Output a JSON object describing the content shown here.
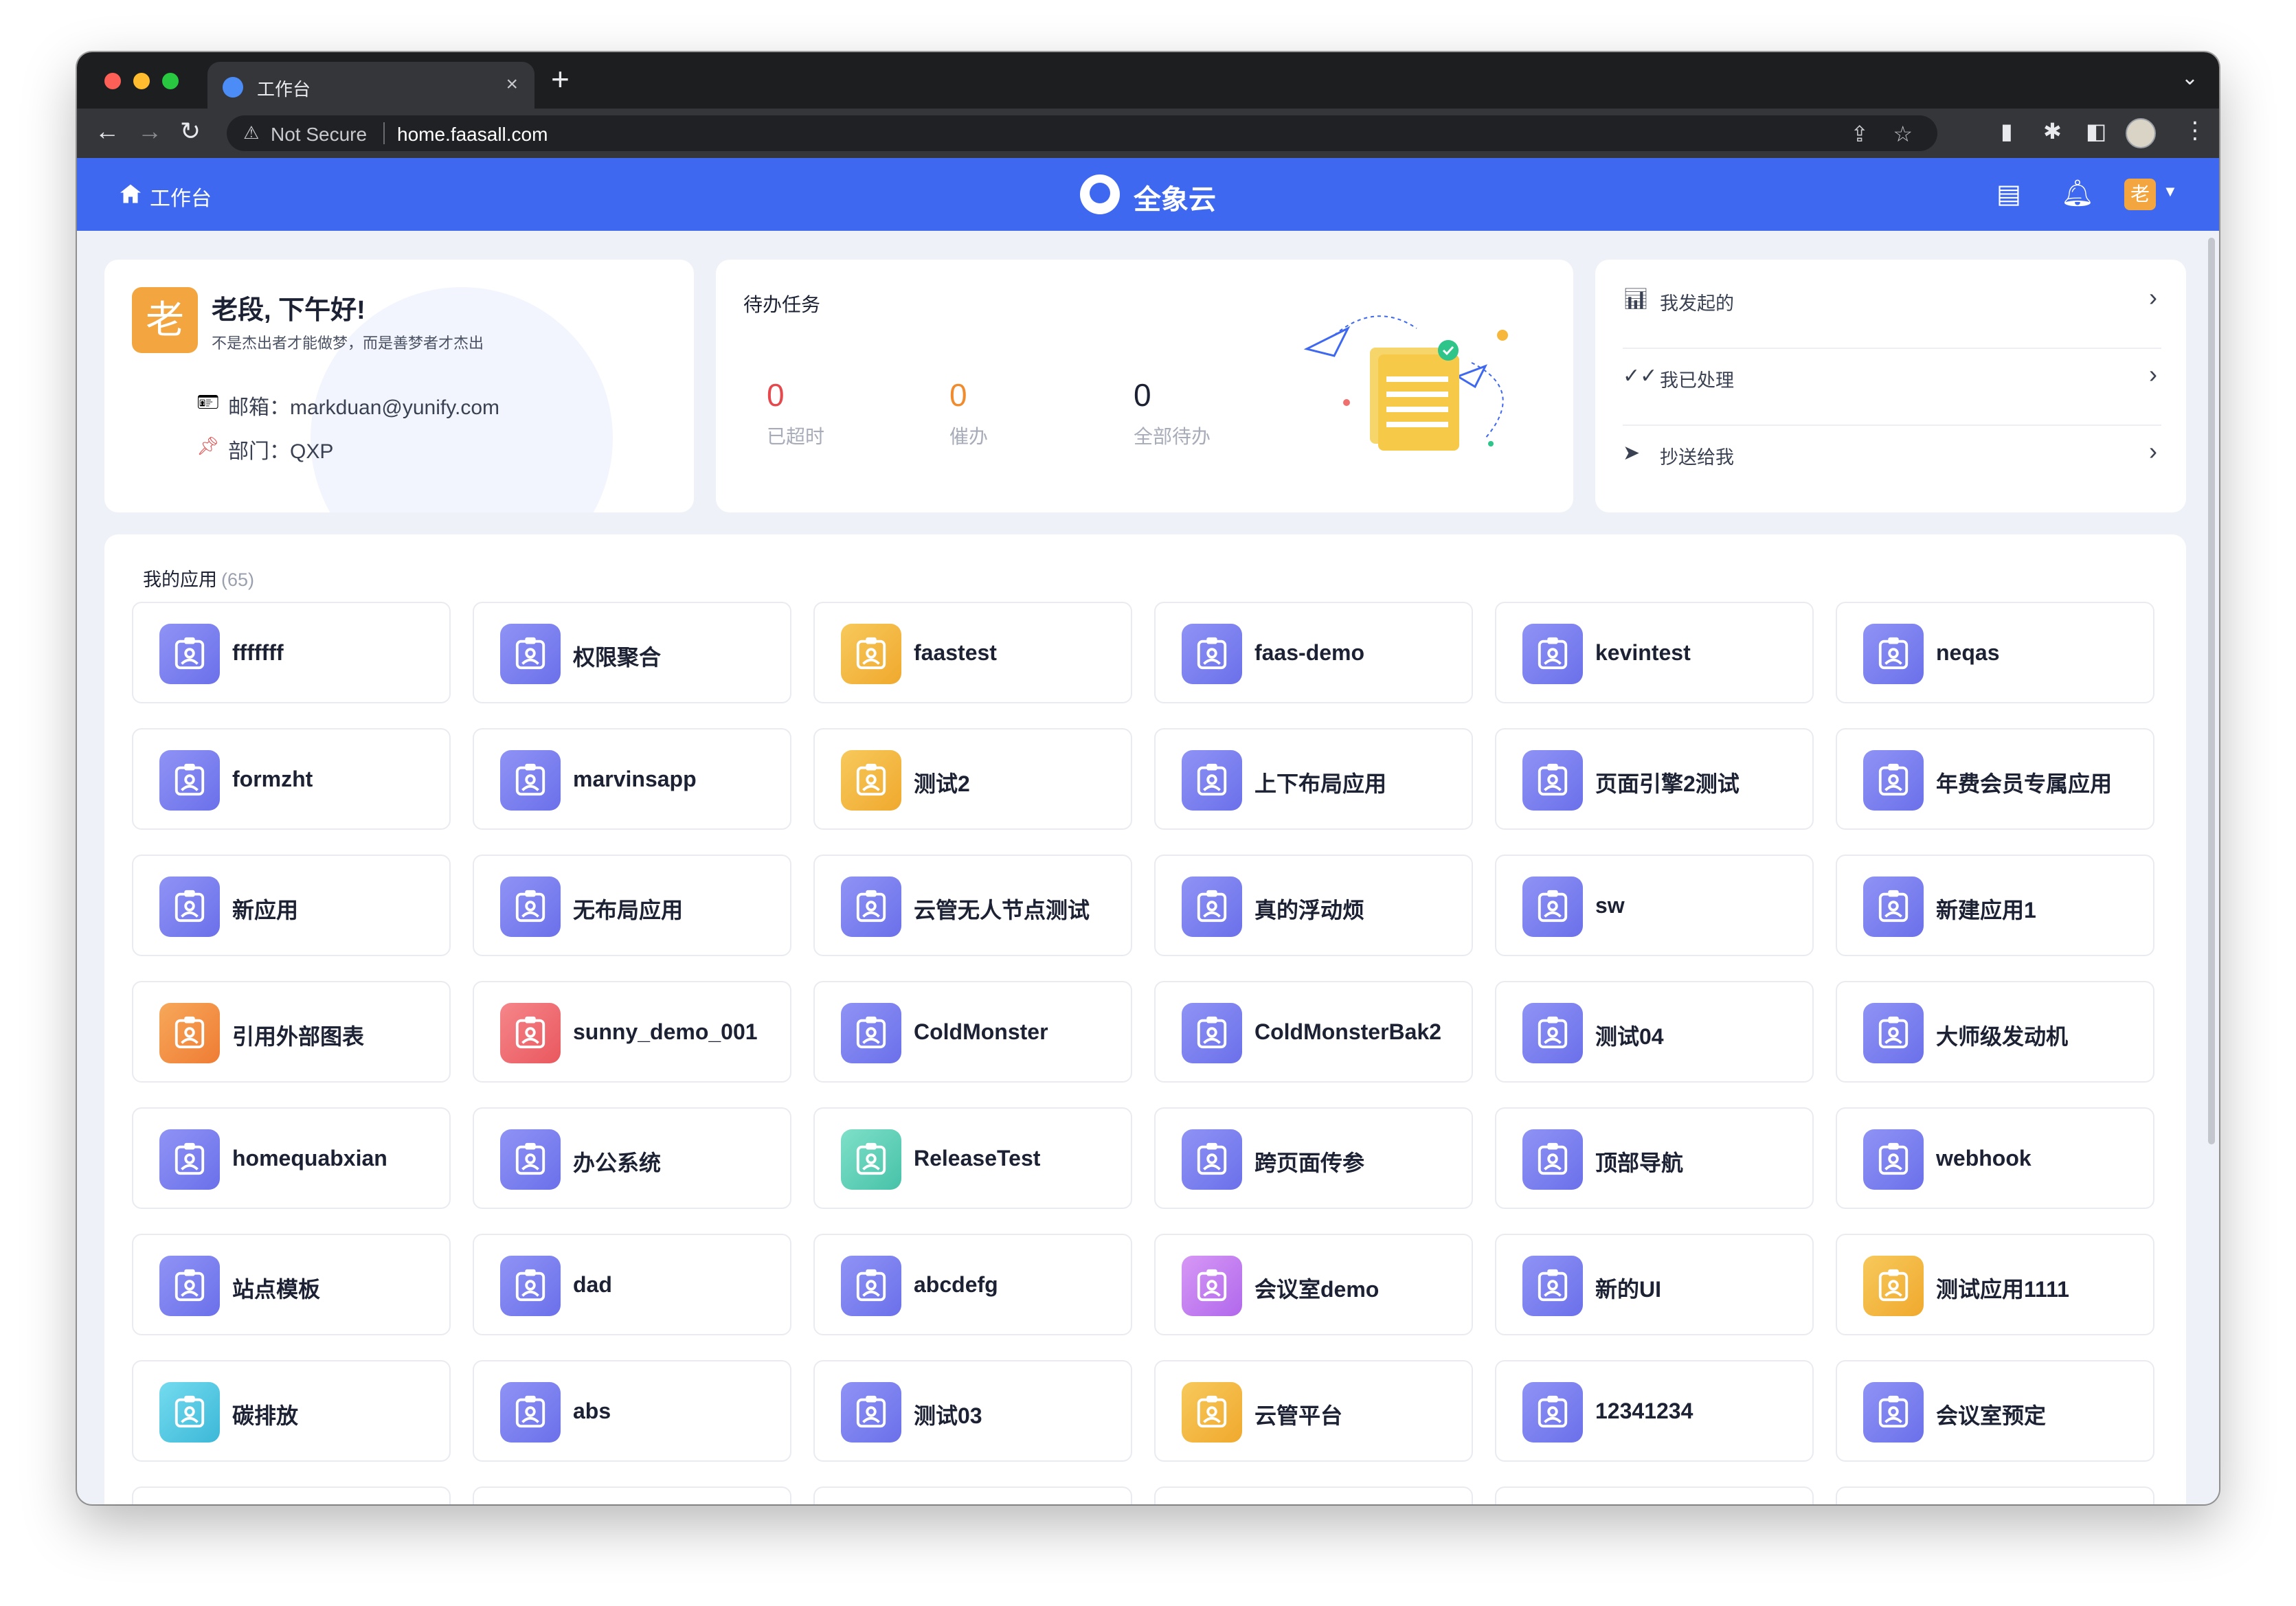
{
  "browser": {
    "tab_title": "工作台",
    "tab_close": "×",
    "new_tab": "+",
    "tab_menu": "⌄",
    "not_secure": "Not Secure",
    "url": "home.faasall.com"
  },
  "header": {
    "home_label": "工作台",
    "brand": "全象云",
    "avatar_text": "老"
  },
  "profile": {
    "avatar_text": "老",
    "greeting": "老段, 下午好!",
    "motto": "不是杰出者才能做梦，而是善梦者才杰出",
    "email_label": "邮箱：",
    "email": "markduan@yunify.com",
    "dept_label": "部门：",
    "dept": "QXP"
  },
  "todo": {
    "title": "待办任务",
    "stats": [
      {
        "value": "0",
        "label": "已超时",
        "color": "#e5484d"
      },
      {
        "value": "0",
        "label": "催办",
        "color": "#f08c2e"
      },
      {
        "value": "0",
        "label": "全部待办",
        "color": "#1c2233"
      }
    ]
  },
  "quick_links": [
    {
      "label": "我发起的",
      "icon": "chart-icon"
    },
    {
      "label": "我已处理",
      "icon": "double-check-icon"
    },
    {
      "label": "抄送给我",
      "icon": "send-icon"
    }
  ],
  "apps": {
    "title": "我的应用",
    "count": "(65)",
    "items": [
      {
        "name": "fffffff",
        "color": "purple"
      },
      {
        "name": "权限聚合",
        "color": "purple"
      },
      {
        "name": "faastest",
        "color": "yellow"
      },
      {
        "name": "faas-demo",
        "color": "purple"
      },
      {
        "name": "kevintest",
        "color": "purple"
      },
      {
        "name": "neqas",
        "color": "purple"
      },
      {
        "name": "formzht",
        "color": "purple"
      },
      {
        "name": "marvinsapp",
        "color": "purple"
      },
      {
        "name": "测试2",
        "color": "yellow"
      },
      {
        "name": "上下布局应用",
        "color": "purple"
      },
      {
        "name": "页面引擎2测试",
        "color": "purple"
      },
      {
        "name": "年费会员专属应用",
        "color": "purple"
      },
      {
        "name": "新应用",
        "color": "purple"
      },
      {
        "name": "无布局应用",
        "color": "purple"
      },
      {
        "name": "云管无人节点测试",
        "color": "purple"
      },
      {
        "name": "真的浮动烦",
        "color": "purple"
      },
      {
        "name": "sw",
        "color": "purple"
      },
      {
        "name": "新建应用1",
        "color": "purple"
      },
      {
        "name": "引用外部图表",
        "color": "orange"
      },
      {
        "name": "sunny_demo_001",
        "color": "red"
      },
      {
        "name": "ColdMonster",
        "color": "purple"
      },
      {
        "name": "ColdMonsterBak2",
        "color": "purple"
      },
      {
        "name": "测试04",
        "color": "purple"
      },
      {
        "name": "大师级发动机",
        "color": "purple"
      },
      {
        "name": "homequabxian",
        "color": "purple"
      },
      {
        "name": "办公系统",
        "color": "purple"
      },
      {
        "name": "ReleaseTest",
        "color": "teal"
      },
      {
        "name": "跨页面传参",
        "color": "purple"
      },
      {
        "name": "顶部导航",
        "color": "purple"
      },
      {
        "name": "webhook",
        "color": "purple"
      },
      {
        "name": "站点模板",
        "color": "purple"
      },
      {
        "name": "dad",
        "color": "purple"
      },
      {
        "name": "abcdefg",
        "color": "purple"
      },
      {
        "name": "会议室demo",
        "color": "violet"
      },
      {
        "name": "新的UI",
        "color": "purple"
      },
      {
        "name": "测试应用1111",
        "color": "yellow"
      },
      {
        "name": "碳排放",
        "color": "cyan"
      },
      {
        "name": "abs",
        "color": "purple"
      },
      {
        "name": "测试03",
        "color": "purple"
      },
      {
        "name": "云管平台",
        "color": "yellow"
      },
      {
        "name": "12341234",
        "color": "purple"
      },
      {
        "name": "会议室预定",
        "color": "purple"
      }
    ]
  },
  "colors": {
    "header_blue": "#3e68f0",
    "purple": "#7b7ff0",
    "yellow": "#f4b63f",
    "orange": "#f39040",
    "red": "#ee6e72",
    "teal": "#5bcfb8",
    "violet": "#c47ef0",
    "cyan": "#4fc8e0"
  }
}
